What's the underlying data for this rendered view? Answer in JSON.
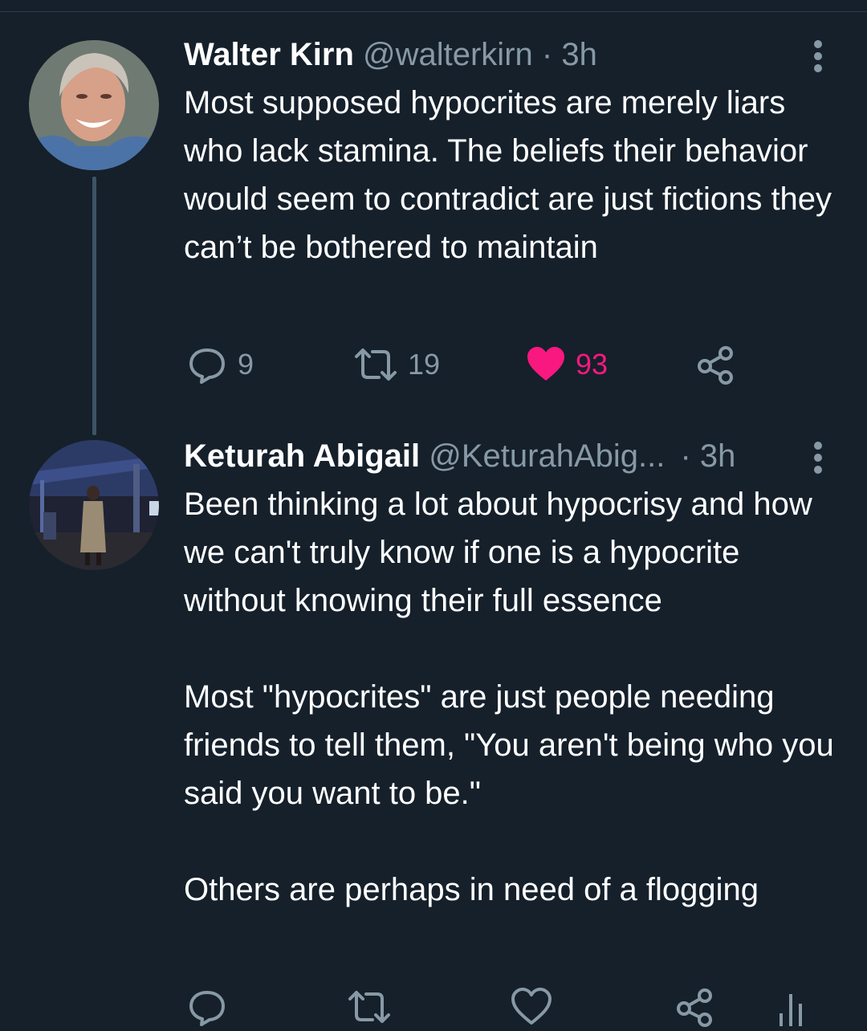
{
  "tweets": [
    {
      "author_name": "Walter Kirn",
      "author_handle": "@walterkirn",
      "separator": "·",
      "time": "3h",
      "text": "Most supposed hypocrites are merely liars who lack stamina. The beliefs their behavior would seem to contradict are just fictions they can’t be bothered to maintain",
      "replies": "9",
      "retweets": "19",
      "likes": "93",
      "liked": true
    },
    {
      "author_name": "Keturah Abigail",
      "author_handle": "@KeturahAbig...",
      "separator": "·",
      "time": "3h",
      "paragraphs": [
        "Been thinking a lot about hypocrisy and how we can't truly know if one is a hypocrite without knowing their full essence",
        "Most \"hypocrites\" are just people needing friends to tell them, \"You aren't being who you said you want to be.\"",
        "Others are perhaps in need of a flogging"
      ]
    }
  ],
  "icons": {
    "reply": "reply-icon",
    "retweet": "retweet-icon",
    "like": "heart-icon",
    "share": "share-icon",
    "analytics": "analytics-icon",
    "more": "more-vertical-icon"
  },
  "colors": {
    "background": "#15202b",
    "text": "#ffffff",
    "secondary": "#8899a6",
    "like": "#f91880",
    "thread_line": "#3d5466"
  }
}
